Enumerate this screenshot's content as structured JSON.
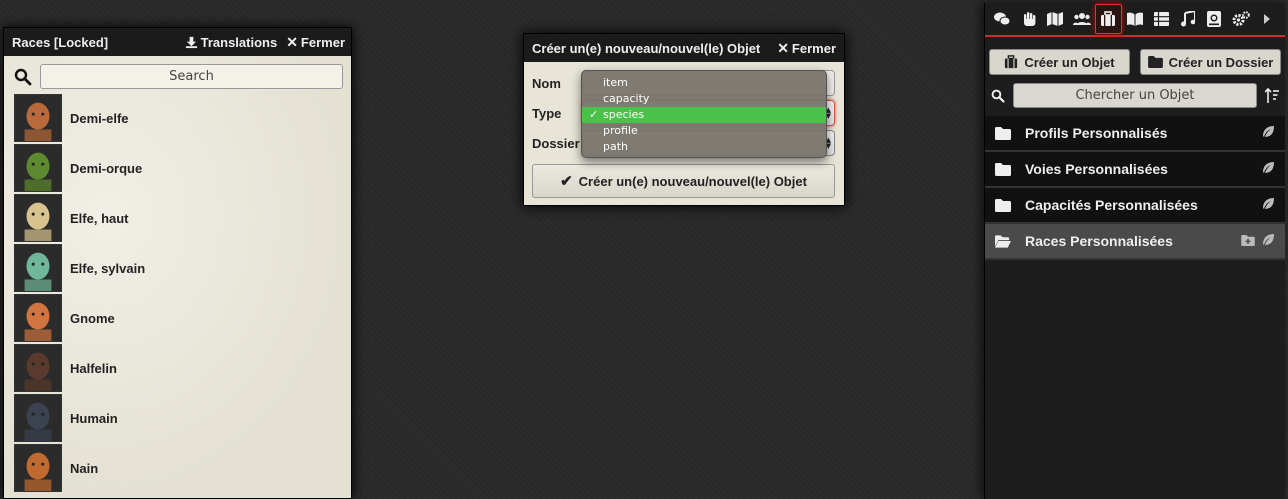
{
  "compendium": {
    "title": "Races [Locked]",
    "translations_label": "Translations",
    "close_label": "Fermer",
    "search_placeholder": "Search",
    "races": [
      {
        "name": "Demi-elfe",
        "color": "#b86a3a"
      },
      {
        "name": "Demi-orque",
        "color": "#5e8a2f"
      },
      {
        "name": "Elfe, haut",
        "color": "#d8c38e"
      },
      {
        "name": "Elfe, sylvain",
        "color": "#6fb79a"
      },
      {
        "name": "Gnome",
        "color": "#d07440"
      },
      {
        "name": "Halfelin",
        "color": "#5a3a2c"
      },
      {
        "name": "Humain",
        "color": "#3b4250"
      },
      {
        "name": "Nain",
        "color": "#c06a2f"
      }
    ]
  },
  "dialog": {
    "title": "Créer un(e) nouveau/nouvel(le) Objet",
    "close_label": "Fermer",
    "name_label": "Nom",
    "type_label": "Type",
    "folder_label": "Dossier",
    "submit_label": "Créer un(e) nouveau/nouvel(le) Objet",
    "type_options": [
      "item",
      "capacity",
      "species",
      "profile",
      "path"
    ],
    "type_selected": "species",
    "selected_color": "#49c24a"
  },
  "sidebar": {
    "tabs": [
      "chat-icon",
      "hand-icon",
      "map-icon",
      "users-icon",
      "suitcase-icon",
      "book-icon",
      "table-icon",
      "music-icon",
      "atlas-icon",
      "cogs-icon",
      "expand-icon"
    ],
    "active_tab": "suitcase-icon",
    "create_item_label": "Créer un Objet",
    "create_folder_label": "Créer un Dossier",
    "search_placeholder": "Chercher un Objet",
    "folders": [
      {
        "name": "Profils Personnalisés",
        "open": false
      },
      {
        "name": "Voies Personnalisées",
        "open": false
      },
      {
        "name": "Capacités Personnalisées",
        "open": false
      },
      {
        "name": "Races Personnalisées",
        "open": true
      }
    ],
    "accent_color": "#c9302c"
  }
}
